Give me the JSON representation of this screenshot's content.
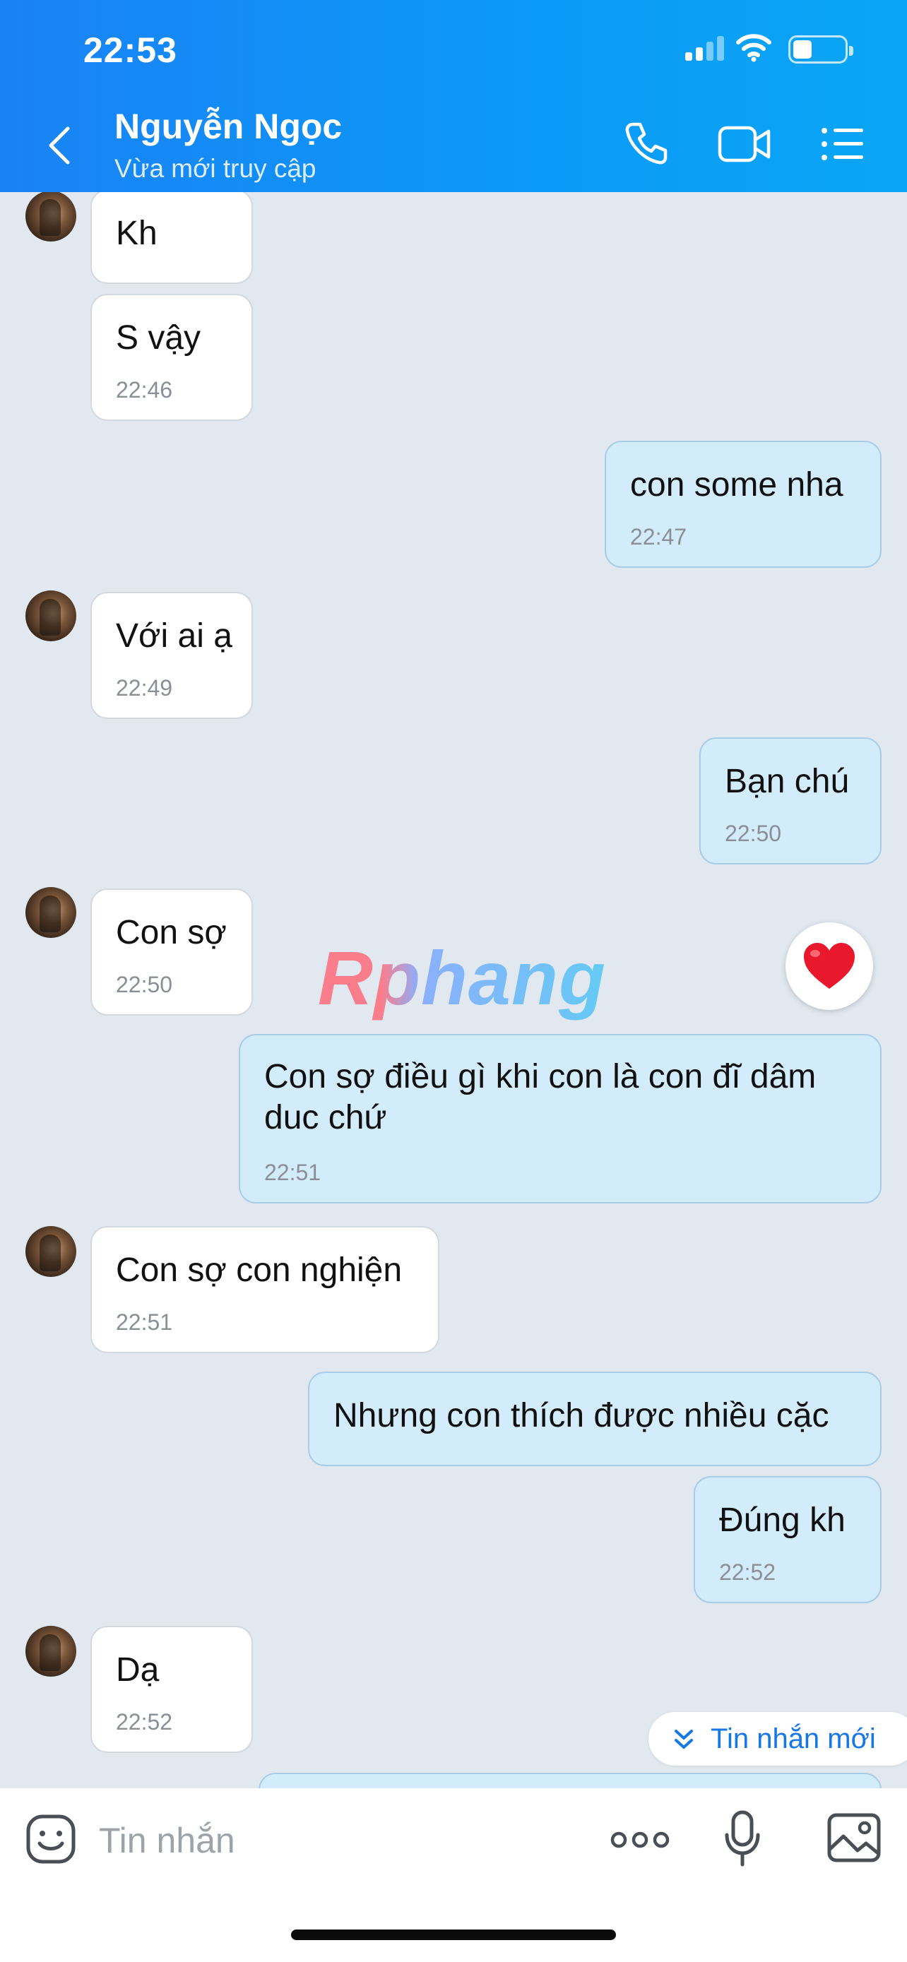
{
  "status_bar": {
    "time": "22:53"
  },
  "header": {
    "contact_name": "Nguyễn Ngọc",
    "contact_status": "Vừa mới truy cập",
    "icons": [
      "back-icon",
      "phone-icon",
      "video-call-icon",
      "menu-list-icon"
    ]
  },
  "messages": [
    {
      "side": "in",
      "text": "Kh",
      "time": ""
    },
    {
      "side": "in",
      "text": "S vậy",
      "time": "22:46"
    },
    {
      "side": "out",
      "text": "con some nha",
      "time": "22:47"
    },
    {
      "side": "in",
      "text": "Với ai ạ",
      "time": "22:49"
    },
    {
      "side": "out",
      "text": "Bạn chú",
      "time": "22:50"
    },
    {
      "side": "in",
      "text": "Con sợ",
      "time": "22:50"
    },
    {
      "side": "out",
      "text": "Con sợ điều gì khi con là con đĩ dâm duc chứ",
      "time": "22:51"
    },
    {
      "side": "in",
      "text": "Con sợ con nghiện",
      "time": "22:51"
    },
    {
      "side": "out",
      "text": "Nhưng con thích được nhiều cặc",
      "time": ""
    },
    {
      "side": "out",
      "text": "Đúng kh",
      "time": "22:52"
    },
    {
      "side": "in",
      "text": "Dạ",
      "time": "22:52"
    }
  ],
  "watermark": "Rphang",
  "new_messages_label": "Tin nhắn mới",
  "input": {
    "placeholder": "Tin nhắn"
  },
  "colors": {
    "header_start": "#1a82f5",
    "header_end": "#0aa6f6",
    "chat_background": "#e2e8f0",
    "incoming_bubble": "#ffffff",
    "outgoing_bubble": "#d3ecfc",
    "accent": "#1677e6",
    "reaction_heart": "#e8192c"
  }
}
